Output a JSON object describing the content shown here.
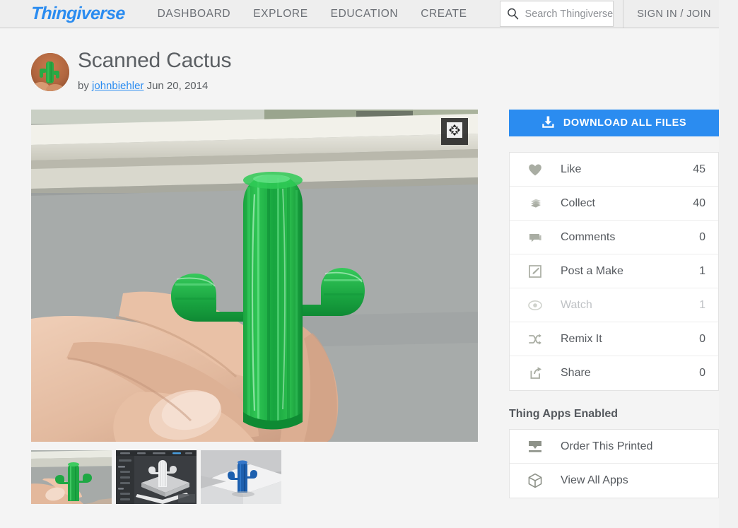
{
  "header": {
    "logo": "Thingiverse",
    "nav": [
      {
        "label": "DASHBOARD"
      },
      {
        "label": "EXPLORE"
      },
      {
        "label": "EDUCATION"
      },
      {
        "label": "CREATE"
      }
    ],
    "search": {
      "value": "",
      "placeholder": "Search Thingiverse",
      "icon": "search-icon"
    },
    "signin_label": "SIGN IN / JOIN",
    "brand_color": "#2b8cf0",
    "background_color": "#eeeeee"
  },
  "thing": {
    "title": "Scanned Cactus",
    "by_prefix": "by",
    "author": "johnbiehler",
    "date": "Jun 20, 2014",
    "avatar_alt": "green 3d printed cactus held in hand"
  },
  "gallery": {
    "expand_icon": "expand-arrows-icon",
    "main_image_alt": "Green 3D printed cactus held in a hand in front of a window sill",
    "thumbnails": [
      {
        "alt": "Green cactus held in hand",
        "type": "photo-green-cactus"
      },
      {
        "alt": "3D modeling software with white cactus model on build plate",
        "type": "screenshot-slicer"
      },
      {
        "alt": "Blue 3D printed cactus on white surface",
        "type": "photo-blue-cactus"
      }
    ]
  },
  "sidebar": {
    "download": {
      "label": "DOWNLOAD ALL FILES",
      "icon": "download-icon",
      "color": "#2b8cf0"
    },
    "stats": [
      {
        "label": "Like",
        "count": "45",
        "icon": "heart-icon",
        "disabled": false
      },
      {
        "label": "Collect",
        "count": "40",
        "icon": "collection-icon",
        "disabled": false
      },
      {
        "label": "Comments",
        "count": "0",
        "icon": "comment-icon",
        "disabled": false
      },
      {
        "label": "Post a Make",
        "count": "1",
        "icon": "edit-square-icon",
        "disabled": false
      },
      {
        "label": "Watch",
        "count": "1",
        "icon": "eye-icon",
        "disabled": true
      },
      {
        "label": "Remix It",
        "count": "0",
        "icon": "shuffle-icon",
        "disabled": false
      },
      {
        "label": "Share",
        "count": "0",
        "icon": "share-icon",
        "disabled": false
      }
    ],
    "apps_title": "Thing Apps Enabled",
    "apps": [
      {
        "label": "Order This Printed",
        "icon": "printer-screen-icon"
      },
      {
        "label": "View All Apps",
        "icon": "cube-icon"
      }
    ]
  }
}
